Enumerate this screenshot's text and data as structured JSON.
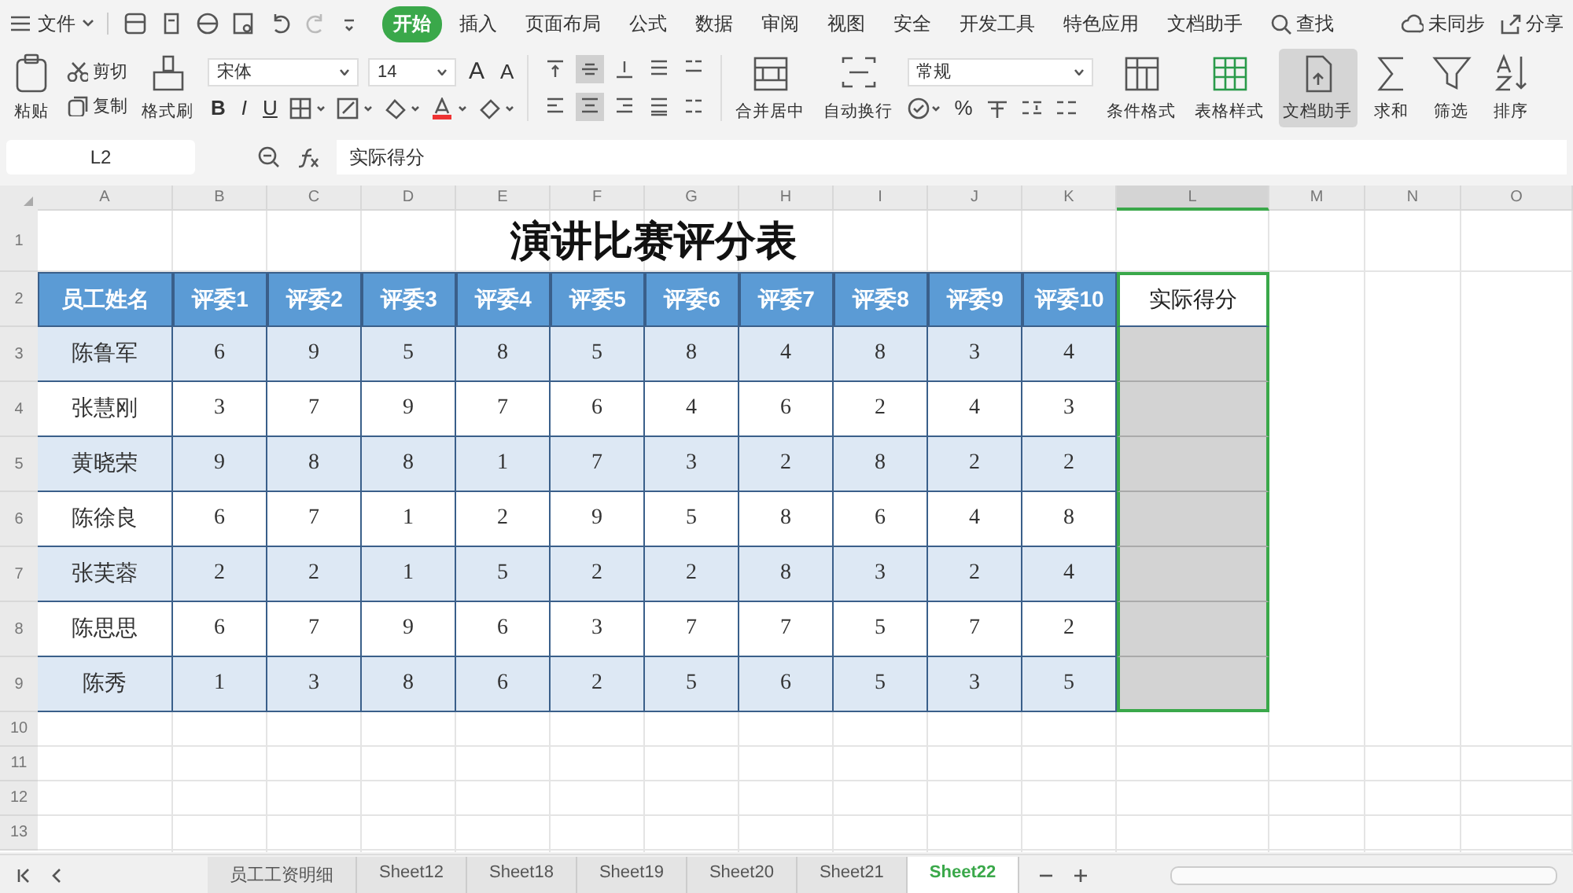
{
  "menu": {
    "label": "文件"
  },
  "tabs": [
    {
      "label": "开始",
      "selected": true
    },
    {
      "label": "插入",
      "selected": false
    },
    {
      "label": "页面布局",
      "selected": false
    },
    {
      "label": "公式",
      "selected": false
    },
    {
      "label": "数据",
      "selected": false
    },
    {
      "label": "审阅",
      "selected": false
    },
    {
      "label": "视图",
      "selected": false
    },
    {
      "label": "安全",
      "selected": false
    },
    {
      "label": "开发工具",
      "selected": false
    },
    {
      "label": "特色应用",
      "selected": false
    },
    {
      "label": "文档助手",
      "selected": false
    }
  ],
  "search": {
    "label": "查找"
  },
  "account": [
    {
      "kind": "sync",
      "label": "未同步"
    },
    {
      "kind": "share",
      "label": "分享"
    }
  ],
  "ribbon": [
    {
      "kind": "paste",
      "label": "粘贴"
    },
    {
      "kind": "pair",
      "items": [
        {
          "kind": "cut",
          "label": "剪切"
        },
        {
          "kind": "copy",
          "label": "复制"
        }
      ]
    },
    {
      "kind": "painter",
      "label": "格式刷"
    },
    {
      "kind": "font",
      "font": "宋体",
      "size": "14",
      "size_buttons": [
        "A",
        "A"
      ],
      "style_buttons": [
        "B",
        "I",
        "U"
      ]
    },
    {
      "kind": "align",
      "buttons": [
        {
          "selected": false
        },
        {
          "selected": true
        },
        {
          "selected": false
        },
        {
          "selected": false
        },
        {
          "selected": false
        },
        {
          "selected": false
        },
        {
          "selected": true
        },
        {
          "selected": false
        },
        {
          "selected": false
        },
        {
          "selected": false
        }
      ]
    },
    {
      "kind": "merge",
      "label": "合并居中"
    },
    {
      "kind": "wrap",
      "label": "自动换行"
    },
    {
      "kind": "number",
      "format": "常规",
      "percent": "%"
    },
    {
      "kind": "cond",
      "label": "条件格式"
    },
    {
      "kind": "tstyle",
      "label": "表格样式"
    },
    {
      "kind": "helper",
      "label": "文档助手",
      "selected": true
    },
    {
      "kind": "sum",
      "label": "求和"
    },
    {
      "kind": "filter",
      "label": "筛选"
    },
    {
      "kind": "sort",
      "label": "排序"
    }
  ],
  "formula_bar": {
    "name_box": "L2",
    "formula": "实际得分"
  },
  "columns": [
    {
      "label": "A",
      "selected": false
    },
    {
      "label": "B",
      "selected": false
    },
    {
      "label": "C",
      "selected": false
    },
    {
      "label": "D",
      "selected": false
    },
    {
      "label": "E",
      "selected": false
    },
    {
      "label": "F",
      "selected": false
    },
    {
      "label": "G",
      "selected": false
    },
    {
      "label": "H",
      "selected": false
    },
    {
      "label": "I",
      "selected": false
    },
    {
      "label": "J",
      "selected": false
    },
    {
      "label": "K",
      "selected": false
    },
    {
      "label": "L",
      "selected": true
    },
    {
      "label": "M",
      "selected": false
    },
    {
      "label": "N",
      "selected": false
    },
    {
      "label": "O",
      "selected": false
    }
  ],
  "row_numbers": [
    "1",
    "2",
    "3",
    "4",
    "5",
    "6",
    "7",
    "8",
    "9",
    "10",
    "11",
    "12",
    "13"
  ],
  "title": "演讲比赛评分表",
  "table": {
    "header": [
      "员工姓名",
      "评委1",
      "评委2",
      "评委3",
      "评委4",
      "评委5",
      "评委6",
      "评委7",
      "评委8",
      "评委9",
      "评委10",
      "实际得分"
    ],
    "rows": [
      {
        "name": "陈鲁军",
        "scores": [
          "6",
          "9",
          "5",
          "8",
          "5",
          "8",
          "4",
          "8",
          "3",
          "4"
        ]
      },
      {
        "name": "张慧刚",
        "scores": [
          "3",
          "7",
          "9",
          "7",
          "6",
          "4",
          "6",
          "2",
          "4",
          "3"
        ]
      },
      {
        "name": "黄晓荣",
        "scores": [
          "9",
          "8",
          "8",
          "1",
          "7",
          "3",
          "2",
          "8",
          "2",
          "2"
        ]
      },
      {
        "name": "陈徐良",
        "scores": [
          "6",
          "7",
          "1",
          "2",
          "9",
          "5",
          "8",
          "6",
          "4",
          "8"
        ]
      },
      {
        "name": "张芙蓉",
        "scores": [
          "2",
          "2",
          "1",
          "5",
          "2",
          "2",
          "8",
          "3",
          "2",
          "4"
        ]
      },
      {
        "name": "陈思思",
        "scores": [
          "6",
          "7",
          "9",
          "6",
          "3",
          "7",
          "7",
          "5",
          "7",
          "2"
        ]
      },
      {
        "name": "陈秀",
        "scores": [
          "1",
          "3",
          "8",
          "6",
          "2",
          "5",
          "6",
          "5",
          "3",
          "5"
        ]
      }
    ]
  },
  "sheets": [
    {
      "label": "员工工资明细",
      "selected": false
    },
    {
      "label": "Sheet12",
      "selected": false
    },
    {
      "label": "Sheet18",
      "selected": false
    },
    {
      "label": "Sheet19",
      "selected": false
    },
    {
      "label": "Sheet20",
      "selected": false
    },
    {
      "label": "Sheet21",
      "selected": false
    },
    {
      "label": "Sheet22",
      "selected": true
    }
  ]
}
